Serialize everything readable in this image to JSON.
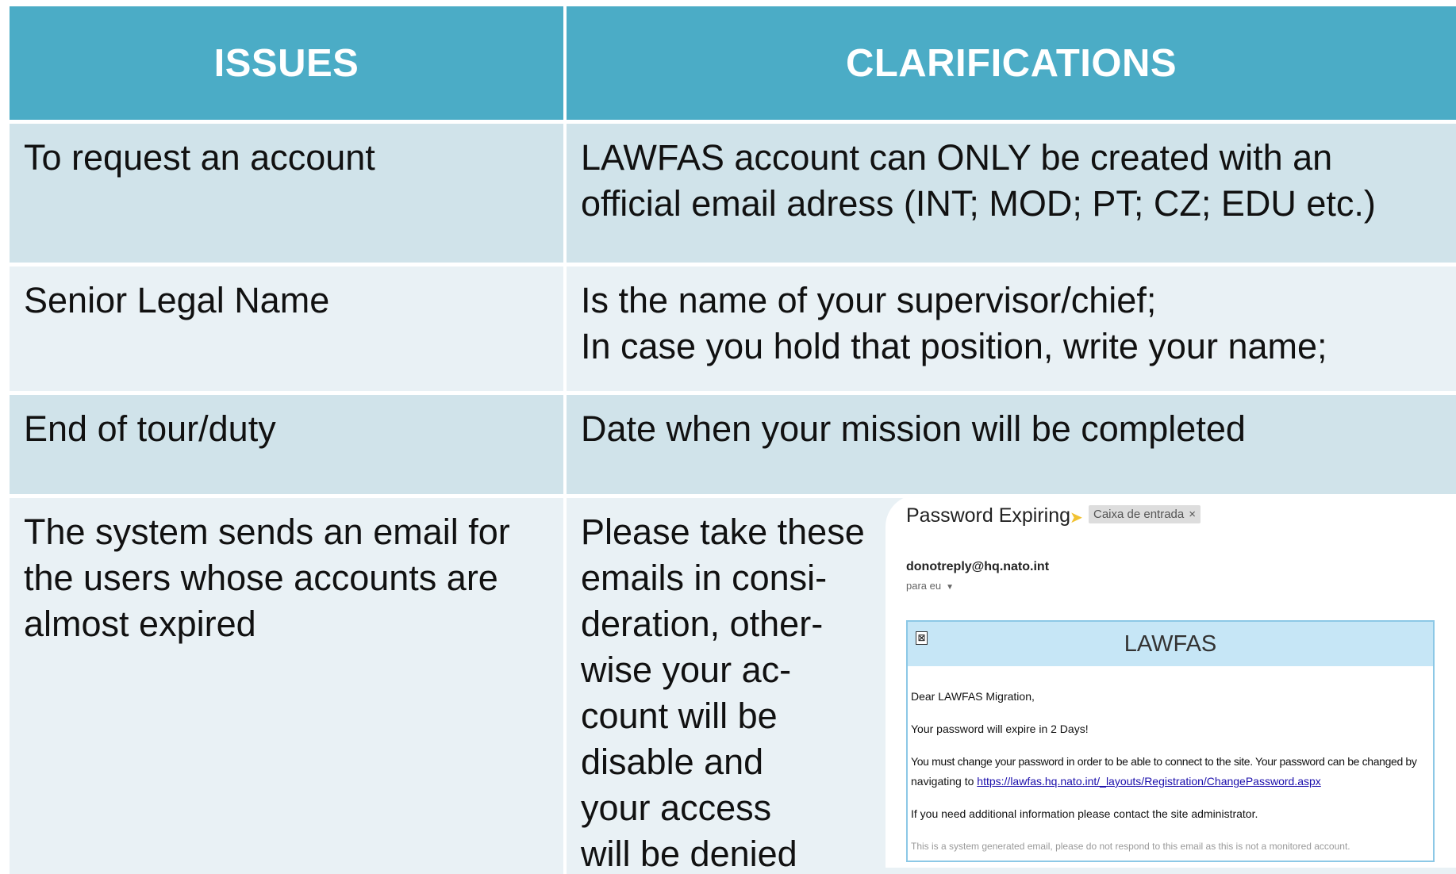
{
  "table": {
    "headers": [
      "ISSUES",
      "CLARIFICATIONS"
    ],
    "rows": [
      {
        "issue": [
          "To request an account"
        ],
        "clarification": [
          "LAWFAS account can ONLY be created with an",
          "official email adress (INT; MOD; PT; CZ; EDU etc.)"
        ]
      },
      {
        "issue": [
          "Senior Legal Name"
        ],
        "clarification": [
          "Is the name of your supervisor/chief;",
          "In case you hold that position, write your name;"
        ]
      },
      {
        "issue": [
          "End of tour/duty"
        ],
        "clarification": [
          "Date when your mission will be completed"
        ]
      },
      {
        "issue": [
          "The system sends an email for",
          "the users whose accounts are",
          "almost expired"
        ],
        "clarification": [
          "Please take these",
          "emails in consi-",
          "deration, other-",
          "wise your ac-",
          "count will be",
          "disable and",
          "your access",
          "will be denied"
        ]
      }
    ]
  },
  "email": {
    "subject": "Password Expiring",
    "label": "Caixa de entrada",
    "label_close": "×",
    "from": "donotreply@hq.nato.int",
    "to": "para eu",
    "banner_title": "LAWFAS",
    "broken_image_glyph": "⊠",
    "greeting": "Dear LAWFAS Migration,",
    "expiry": "Your password will expire in 2 Days!",
    "change_line1": "You must change your password in order to be able to connect to the site. Your password can be changed by",
    "change_line2_prefix": "navigating to ",
    "change_link": "https://lawfas.hq.nato.int/_layouts/Registration/ChangePassword.aspx",
    "contact": "If you need additional information please contact the site administrator.",
    "footer": "This is a system generated email, please do not respond to this email as this is not a monitored account."
  },
  "colors": {
    "header_bg": "#4bacc6",
    "row_dark": "#d0e3ea",
    "row_light": "#e9f1f5",
    "email_banner": "#c6e6f6"
  }
}
